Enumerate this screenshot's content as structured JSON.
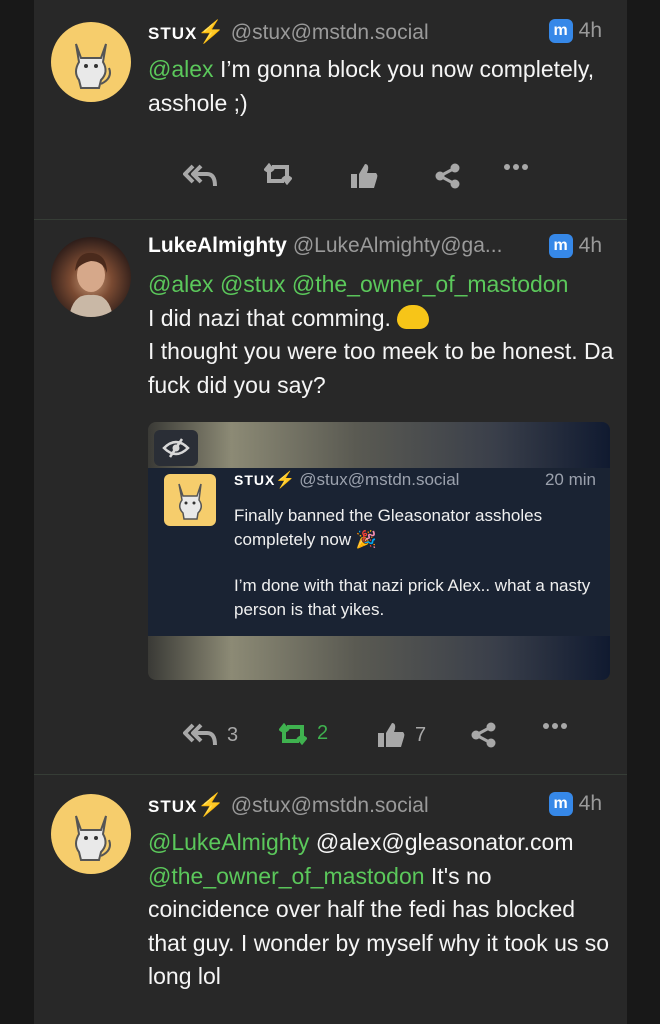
{
  "posts": [
    {
      "display_name": "STUX",
      "handle": "@stux@mstdn.social",
      "time": "4h",
      "server_icon": "m",
      "mention_lines": [
        "@alex"
      ],
      "text": "I’m gonna block you now completely, asshole ;)",
      "actions": {
        "reply": "",
        "boost": "",
        "like": "",
        "share": "",
        "more": ""
      }
    },
    {
      "display_name": "LukeAlmighty",
      "handle": "@LukeAlmighty@ga...",
      "time": "4h",
      "server_icon": "m",
      "mentions": [
        "@alex",
        "@stux",
        "@the_owner_of_mastodon"
      ],
      "line1": "I did nazi that comming.",
      "line2": "I thought you were too meek to be honest. Da fuck did you say?",
      "quote": {
        "display_name": "STUX",
        "handle": "@stux@mstdn.social",
        "time": "20 min",
        "para1": "Finally banned the Gleasonator assholes completely now 🎉",
        "para2": "I’m done with that nazi prick Alex.. what a nasty person is that yikes."
      },
      "actions": {
        "reply": "3",
        "boost": "2",
        "like": "7"
      }
    },
    {
      "display_name": "STUX",
      "handle": "@stux@mstdn.social",
      "time": "4h",
      "server_icon": "m",
      "mention1": "@LukeAlmighty",
      "mention2_plain": "@alex@gleasonator.com",
      "mention3": "@the_owner_of_mastodon",
      "text": "It's no coincidence over half the fedi has blocked that guy. I wonder by myself why it took us so long lol"
    }
  ],
  "colors": {
    "accent_green": "#5bc85b",
    "boost_green": "#3fb24f",
    "mastodon_blue": "#3688e8",
    "bolt": "#f5a623"
  },
  "icons": [
    "reply-all-icon",
    "boost-icon",
    "like-icon",
    "share-icon",
    "more-icon",
    "mastodon-icon",
    "eye-off-icon",
    "lightning-icon"
  ]
}
